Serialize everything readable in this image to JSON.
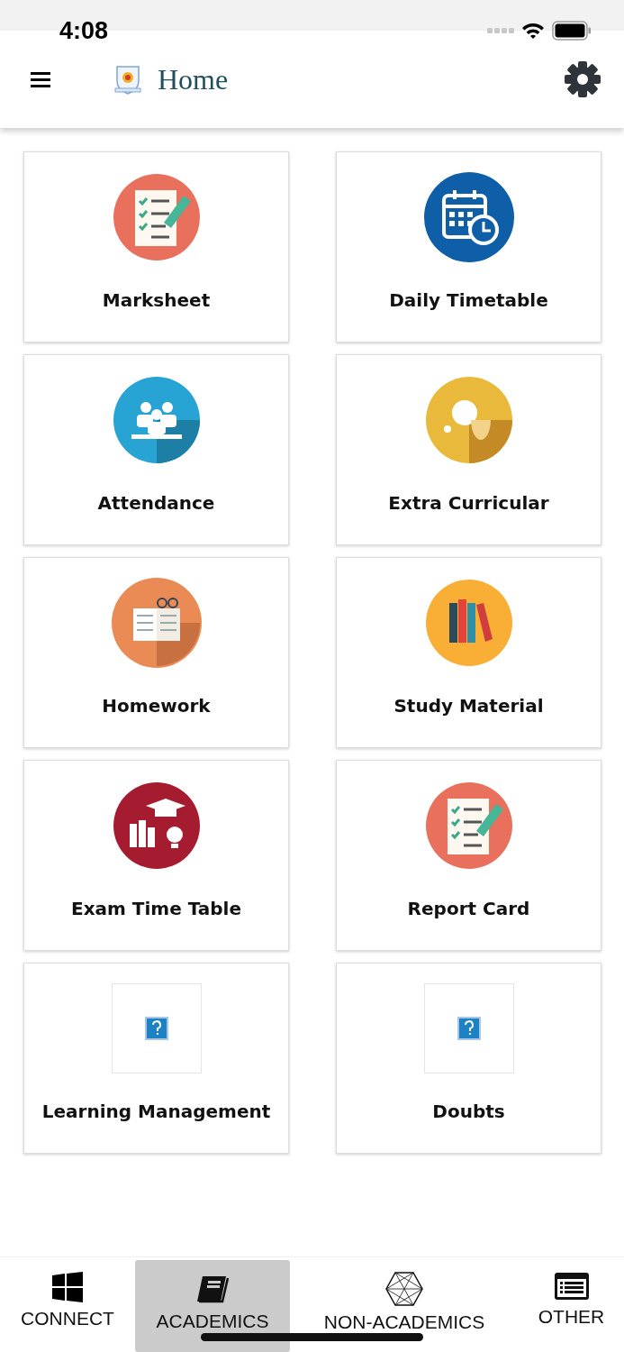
{
  "status_bar": {
    "time": "4:08"
  },
  "header": {
    "title": "Home"
  },
  "tiles": [
    {
      "label": "Marksheet",
      "kind": "checklist"
    },
    {
      "label": "Daily Timetable",
      "kind": "calendar"
    },
    {
      "label": "Attendance",
      "kind": "group"
    },
    {
      "label": "Extra Curricular",
      "kind": "masks"
    },
    {
      "label": "Homework",
      "kind": "notebook"
    },
    {
      "label": "Study Material",
      "kind": "books"
    },
    {
      "label": "Exam Time Table",
      "kind": "exam"
    },
    {
      "label": "Report Card",
      "kind": "checklist"
    },
    {
      "label": "Learning Management",
      "kind": "broken"
    },
    {
      "label": "Doubts",
      "kind": "broken"
    }
  ],
  "tab_bar": [
    {
      "label": "CONNECT",
      "kind": "windows",
      "selected": false
    },
    {
      "label": "ACADEMICS",
      "kind": "book",
      "selected": true
    },
    {
      "label": "NON-ACADEMICS",
      "kind": "hexagon",
      "selected": false
    },
    {
      "label": "OTHER",
      "kind": "list",
      "selected": false
    }
  ]
}
